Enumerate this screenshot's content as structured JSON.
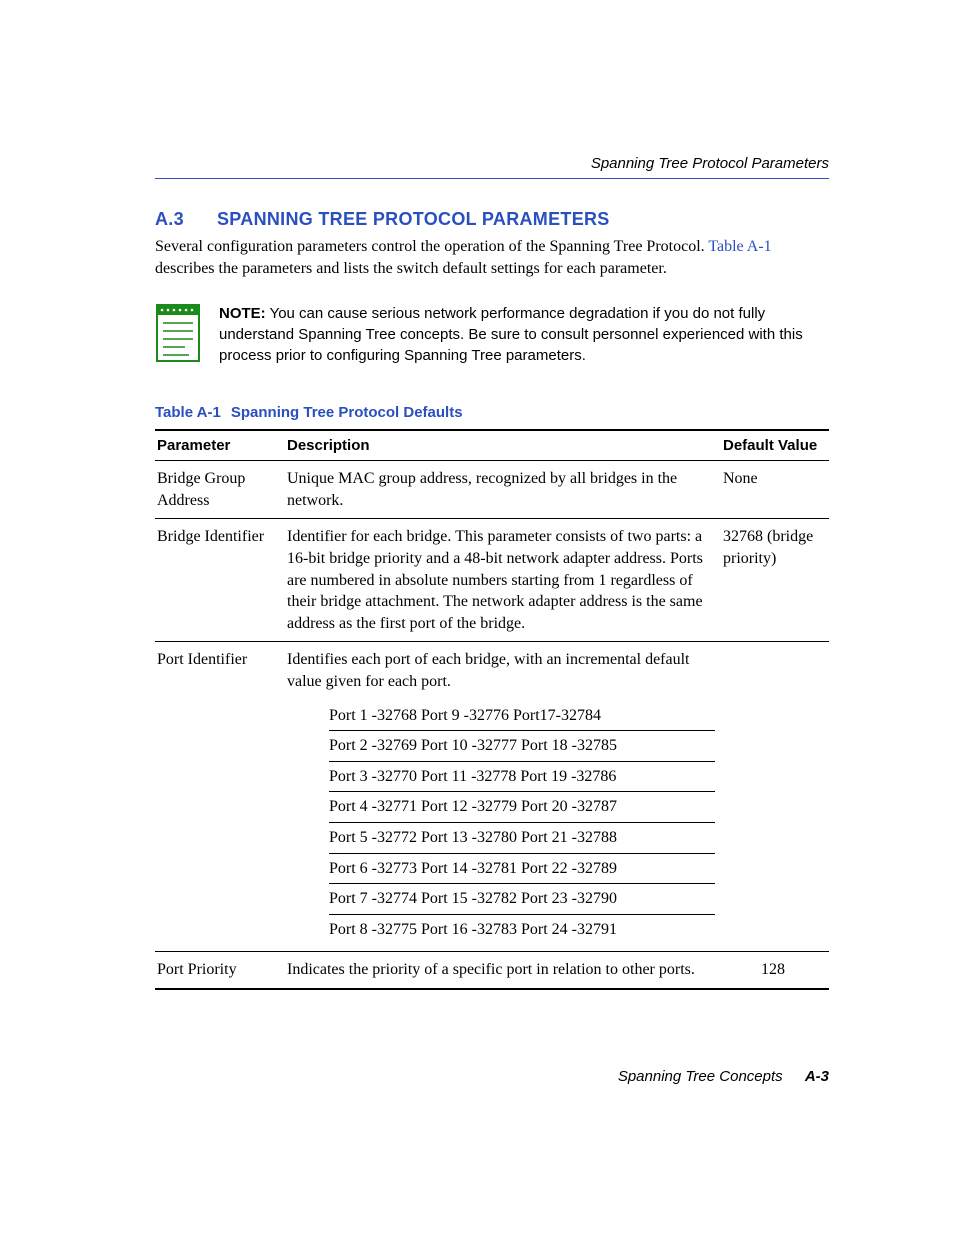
{
  "runningHead": "Spanning Tree Protocol Parameters",
  "section": {
    "number": "A.3",
    "title": "SPANNING TREE PROTOCOL PARAMETERS"
  },
  "intro": {
    "text_before": "Several configuration parameters control the operation of the Spanning Tree Protocol. ",
    "link": "Table A-1",
    "text_after": " describes the parameters and lists the switch default settings for each parameter."
  },
  "note": {
    "label": "NOTE:",
    "body": "  You can cause serious network performance degradation if you do not fully understand Spanning Tree concepts. Be sure to consult personnel experienced with this process prior to configuring Spanning Tree parameters."
  },
  "table": {
    "number": "Table A-1",
    "title": "Spanning Tree Protocol Defaults",
    "headers": {
      "param": "Parameter",
      "desc": "Description",
      "def": "Default Value"
    },
    "rows": {
      "r0": {
        "param": "Bridge Group Address",
        "desc": "Unique MAC group address, recognized by all bridges in the network.",
        "def": "None"
      },
      "r1": {
        "param": "Bridge Identifier",
        "desc": "Identifier for each bridge. This parameter consists of two parts: a 16-bit bridge priority and a 48-bit network adapter address. Ports are numbered in absolute numbers starting from 1 regardless of their bridge attachment. The network adapter address is the same address as the first port of the bridge.",
        "def": "32768 (bridge priority)"
      },
      "r2": {
        "param": "Port Identifier",
        "desc": "Identifies each port of each bridge, with an incremental default value given for each port.",
        "def": "",
        "ports": {
          "l0": "Port 1 -32768 Port 9 -32776 Port17-32784",
          "l1": "Port 2 -32769 Port 10 -32777 Port 18 -32785",
          "l2": "Port 3 -32770 Port 11 -32778 Port 19 -32786",
          "l3": "Port 4 -32771 Port 12 -32779 Port 20 -32787",
          "l4": "Port 5 -32772 Port 13 -32780 Port 21 -32788",
          "l5": "Port 6 -32773 Port 14 -32781 Port 22 -32789",
          "l6": "Port 7 -32774 Port 15 -32782 Port 23 -32790",
          "l7": "Port 8 -32775 Port 16 -32783 Port 24 -32791"
        }
      },
      "r3": {
        "param": "Port Priority",
        "desc": "Indicates the priority of a specific port in relation to other ports.",
        "def": "128"
      }
    }
  },
  "footer": {
    "title": "Spanning Tree Concepts",
    "page": "A-3"
  }
}
